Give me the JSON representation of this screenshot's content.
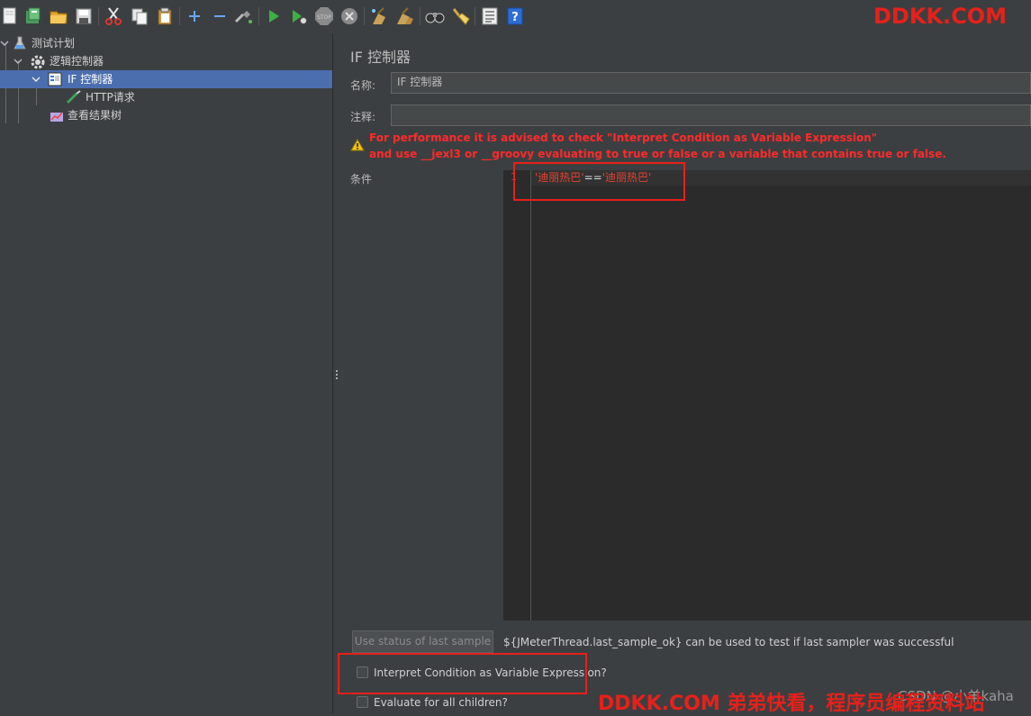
{
  "toolbar": {
    "icons": [
      "new-icon",
      "templates-icon",
      "open-icon",
      "save-icon",
      "cut-icon",
      "copy-icon",
      "paste-icon",
      "expand-icon",
      "collapse-icon",
      "toggle-icon",
      "start-icon",
      "start-no-pause-icon",
      "stop-icon",
      "shutdown-icon",
      "clear-icon",
      "clear-all-icon",
      "search-icon",
      "reset-search-icon",
      "function-helper-icon",
      "help-icon"
    ]
  },
  "watermark": {
    "top": "DDKK.COM",
    "bottom": "DDKK.COM 弟弟快看，程序员编程资料站",
    "bottom_behind": "CSDN @小羊kaha"
  },
  "tree": {
    "items": [
      {
        "label": "测试计划",
        "icon": "test-plan-icon"
      },
      {
        "label": "逻辑控制器",
        "icon": "gear-icon"
      },
      {
        "label": "IF 控制器",
        "icon": "if-controller-icon"
      },
      {
        "label": "HTTP请求",
        "icon": "pipette-icon"
      },
      {
        "label": "查看结果树",
        "icon": "result-tree-icon"
      }
    ]
  },
  "panel": {
    "title": "IF 控制器",
    "name_label": "名称:",
    "name_value": "IF 控制器",
    "comment_label": "注释:",
    "comment_value": "",
    "warning_line1": "For performance it is advised to check \"Interpret Condition as Variable Expression\"",
    "warning_line2": "and use __jexl3 or __groovy evaluating to true or false or a variable that contains true or false.",
    "condition_label": "条件",
    "code": {
      "line_number": "1",
      "str1": "'迪丽热巴'",
      "operator": "==",
      "str2": "'迪丽热巴'"
    },
    "use_status_button": "Use status of last sample",
    "hint_text": "${JMeterThread.last_sample_ok} can be used to test if last sampler was successful",
    "checkbox1_label": "Interpret Condition as Variable Expression?",
    "checkbox1_checked": false,
    "checkbox2_label": "Evaluate for all children?",
    "checkbox2_checked": false
  },
  "colors": {
    "background": "#3c3f41",
    "selection": "#4b6eaf",
    "editor": "#2b2b2b",
    "warning_red": "#ff2a2a",
    "watermark_red": "#e8201a"
  }
}
